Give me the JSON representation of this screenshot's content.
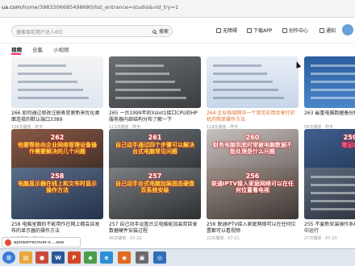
{
  "addressbar": {
    "host": "ua.com",
    "path": "/home/3983306685498680/list_entrance=studio&vid_try=1"
  },
  "header": {
    "search_placeholder": "搜索目前用户达人6亿",
    "search_button": "搜索",
    "nav": [
      "无障碍",
      "下载APP",
      "创作中心",
      "通知"
    ]
  },
  "tabs": [
    "视频",
    "合集",
    "小视频"
  ],
  "cards": [
    {
      "title": "266 如何通过修改注册表变更新来优化桌面连接的默认端口3389",
      "meta": "136次播放 · 昨天",
      "overlay": "",
      "duration": "",
      "theme": "screen1"
    },
    {
      "title": "265 一台1999年的Xslot1接口CPU的HP服务器内部结构分布了解一下",
      "meta": "113次播放 · 昨天",
      "overlay": "",
      "duration": "",
      "theme": "server"
    },
    {
      "title": "264 企业局域网中一个常见应用共享打印机的简单操作方法",
      "meta": "118次播放 · 昨天",
      "overlay": "",
      "duration": "",
      "theme": "screen2"
    },
    {
      "title": "263 最重电脑数据备份解决方法",
      "meta": "58次播放 · 昨天",
      "overlay": "",
      "duration": "",
      "theme": "screen3"
    },
    {
      "title": "262 他要帮助向企业网络管理设备操作需要解决的几个常见问题？",
      "meta": "13次播放 · 07-31",
      "overlay": "262\n他要帮助向企业网络管理设备操作需要解决的几个问题",
      "duration": "05:36",
      "theme": "photo1"
    },
    {
      "title": "261 自己动手通过四个步骤可以解决台式电脑常见的多条问题",
      "meta": "16次播放 · 07-29",
      "overlay": "261\n自己动手通过四个步骤可以解决台式电脑常见问题",
      "duration": "",
      "theme": "photo2"
    },
    {
      "title": "260 财务电脑到底知道不能用作企业服务线上电线或条件时就就是时电脑",
      "meta": "70次播放 · 07-27",
      "overlay": "260\n财务电脑到底时常被电脑数据不能处理是什么问题",
      "duration": "",
      "theme": "photo3"
    },
    {
      "title": "259 笔记本电脑干化操作以下是拆解方案",
      "meta": "33次播放 · 07-26",
      "overlay": "259\n笔记本",
      "duration": "",
      "theme": "photo4"
    },
    {
      "title": "258 电脑里面的不能用作在网上都会自发布的显示器的操作方法",
      "meta": "14次播放 · 07-24",
      "overlay": "258\n电脑显示器在线上和文布时显示操作方法",
      "duration": "",
      "theme": "photo5"
    },
    {
      "title": "257 自己动手设置台式电脑能加装双目录数据硬件安装过程",
      "meta": "45次播放 · 07-22",
      "overlay": "257\n自己动手台式电脑加装固态硬盘双系统安装",
      "duration": "",
      "theme": "photo6"
    },
    {
      "title": "256 联通IPTV接入家庭网络可以在任何位置都可以看视频",
      "meta": "22次播放 · 07-21",
      "overlay": "256\n联通IPTV接入家庭网络可以在任何位置看电视",
      "duration": "",
      "theme": "photo7"
    },
    {
      "title": "255 不要新安装操作系统RAID1的服务器中运行",
      "meta": "27次播放 · 07-20",
      "overlay": "",
      "duration": "",
      "theme": "photo8"
    }
  ],
  "download": {
    "label": "apowerrecover-s....exe",
    "side_text": "07119612115"
  },
  "taskbar": {
    "clock": ""
  },
  "colors": {
    "overlay_yellow": "#f7e23a",
    "overlay_red": "#e62b2b",
    "overlay_pink": "#ff5fa0",
    "accent": "#fe2c55"
  }
}
